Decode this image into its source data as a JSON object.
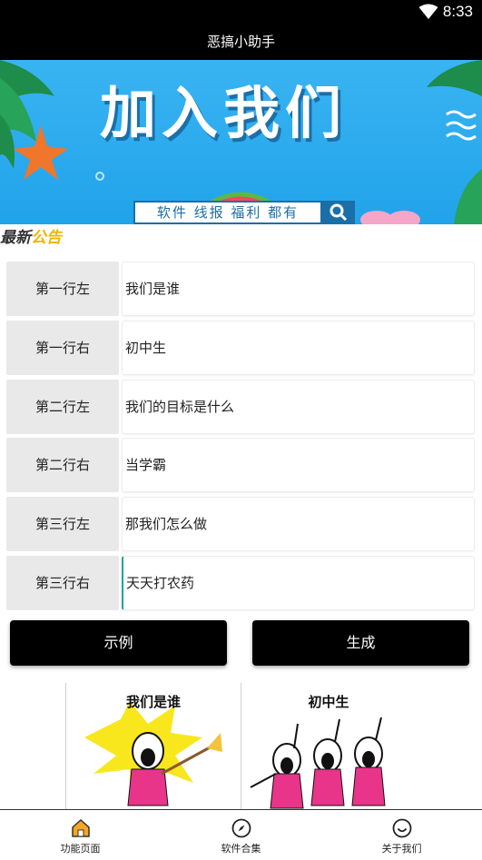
{
  "status_bar": {
    "time": "8:33"
  },
  "app_bar": {
    "title": "恶搞小助手"
  },
  "banner": {
    "title": "加入我们",
    "search_text": "软件 线报 福利 都有"
  },
  "notice": {
    "title_part1": "最新",
    "title_part2": "公告"
  },
  "rows": [
    {
      "label": "第一行左",
      "value": "我们是谁"
    },
    {
      "label": "第一行右",
      "value": "初中生"
    },
    {
      "label": "第二行左",
      "value": "我们的目标是什么"
    },
    {
      "label": "第二行右",
      "value": "当学霸"
    },
    {
      "label": "第三行左",
      "value": "那我们怎么做"
    },
    {
      "label": "第三行右",
      "value": "天天打农药"
    }
  ],
  "buttons": {
    "example": "示例",
    "generate": "生成"
  },
  "meme": {
    "left_caption": "我们是谁",
    "right_caption": "初中生"
  },
  "tabs": [
    {
      "label": "功能页面",
      "icon": "home-icon",
      "active": true
    },
    {
      "label": "软件合集",
      "icon": "compass-icon",
      "active": false
    },
    {
      "label": "关于我们",
      "icon": "smile-icon",
      "active": false
    }
  ],
  "colors": {
    "accent": "#f5a623",
    "banner_blue": "#2aa8ee",
    "button": "#000000"
  }
}
